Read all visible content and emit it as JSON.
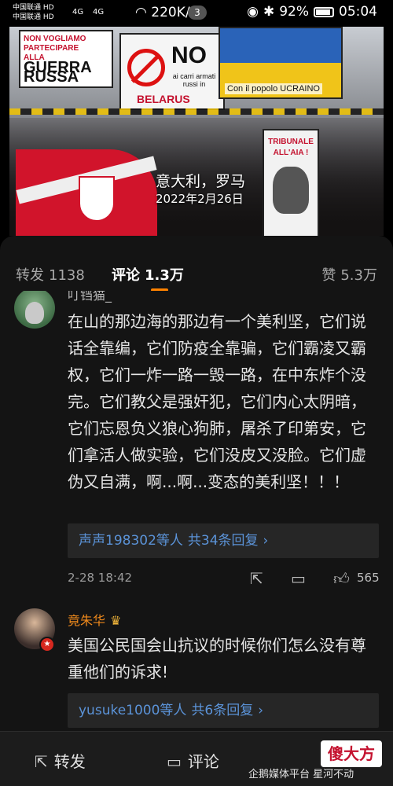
{
  "status_bar": {
    "carrier_1": "中国联通 HD",
    "carrier_2": "中国联通 HD",
    "network_1": "4G",
    "network_2": "4G",
    "speed": "220K/s",
    "notification_count": "3",
    "battery": "92%",
    "time": "05:04"
  },
  "photo": {
    "caption_place": "意大利，罗马",
    "caption_date": "2022年2月26日",
    "sign_left_lines": [
      "NON VOGLIAMO",
      "PARTECIPARE",
      "ALLA",
      "GUERRA RUSSA"
    ],
    "sign_no_main": "NO",
    "sign_no_sub": "ai carri armati russi in",
    "sign_no_country": "BELARUS",
    "sign_ukraine_text": "Con il popolo UCRAINO",
    "sign_tribunal_line1": "TRIBUNALE",
    "sign_tribunal_line2": "ALL'AIA !"
  },
  "tabs": {
    "repost_label": "转发",
    "repost_count": "1138",
    "comment_label": "评论",
    "comment_count": "1.3万",
    "like_label": "赞",
    "like_count": "5.3万"
  },
  "comments": [
    {
      "username": "叮铛猫_",
      "text": "在山的那边海的那边有一个美利坚，它们说话全靠编，它们防疫全靠骗，它们霸凌又霸权，它们一炸一路一毁一路，在中东炸个没完。它们教父是强奸犯，它们内心太阴暗，它们忘恩负义狼心狗肺，屠杀了印第安，它们拿活人做实验，它们没皮又没脸。它们虚伪又自满，啊...啊...变态的美利坚！！！",
      "reply_users": "声声198302等人",
      "reply_count": "共34条回复",
      "date": "2-28 18:42",
      "likes": "565"
    },
    {
      "username": "竟朱华",
      "text": "美国公民国会山抗议的时候你们怎么没有尊重他们的诉求!",
      "reply_users": "yusuke1000等人",
      "reply_count": "共6条回复"
    }
  ],
  "bottom_bar": {
    "repost_label": "转发",
    "comment_label": "评论"
  },
  "watermark": {
    "text": "企鹅媒体平台 星河不动",
    "logo": "傻大方"
  },
  "colors": {
    "accent": "#ff8200",
    "link": "#5b93d8",
    "vip_name": "#f08a1c"
  }
}
